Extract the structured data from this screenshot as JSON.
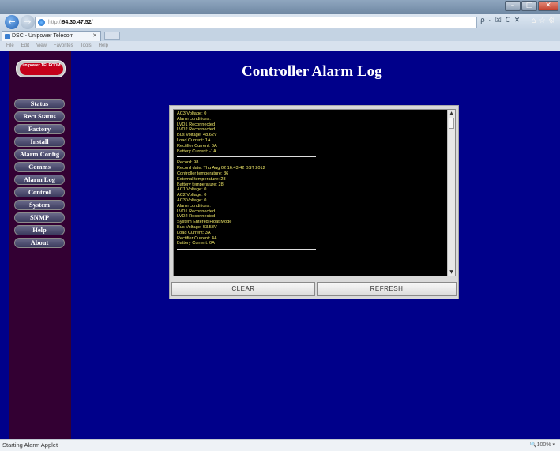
{
  "browser": {
    "url_protocol": "http://",
    "url_host": "94.30.47.52/",
    "search_tools": "ρ - ☒ C ✕",
    "home_icons": "⌂ ☆ ⚙",
    "tab_title": "DSC - Unipower Telecom",
    "tab_close": "✕",
    "menu": [
      "File",
      "Edit",
      "View",
      "Favorites",
      "Tools",
      "Help"
    ],
    "window_controls": {
      "minimize": "–",
      "maximize": "□",
      "close": "✕"
    },
    "back_glyph": "←",
    "forward_glyph": "→"
  },
  "page": {
    "title": "Controller Alarm Log",
    "logo_text": "unipower TELECOM",
    "nav": [
      "Status",
      "Rect Status",
      "Factory",
      "Install",
      "Alarm Config",
      "Comms",
      "Alarm Log",
      "Control",
      "System",
      "SNMP",
      "Help",
      "About"
    ]
  },
  "log": {
    "block1": [
      "AC3 Voltage: 0",
      "Alarm conditions:",
      "LVD1 Reconnected",
      "LVD2 Reconnected",
      "Bus Voltage: 48.62V",
      "Load Current: 1A",
      "Rectifier Current: 0A",
      "Battery Current: -1A"
    ],
    "block2": [
      "Record: 98",
      "Record date: Thu Aug 02 16:43:42 BST 2012",
      "Controller temperature: 36",
      "External temperature: 28",
      "Battery temperature: 28",
      "AC1 Voltage: 0",
      "AC2 Voltage: 0",
      "AC3 Voltage: 0",
      "Alarm conditions:",
      "LVD1 Reconnected",
      "LVD2 Reconnected",
      "System Entered Float Mode",
      "Bus Voltage: 53.53V",
      "Load Current: 3A",
      "Rectifier Current: 4A",
      "Battery Current: 0A"
    ],
    "scroll_up": "▲",
    "scroll_down": "▼"
  },
  "buttons": {
    "clear": "CLEAR",
    "refresh": "REFRESH"
  },
  "status": {
    "text": "Starting Alarm Applet",
    "zoom": "🔍100% ▾"
  },
  "colors": {
    "page_background": "#00008a",
    "sidebar": "#330033",
    "log_text": "#f0e868",
    "log_background": "#000000"
  }
}
